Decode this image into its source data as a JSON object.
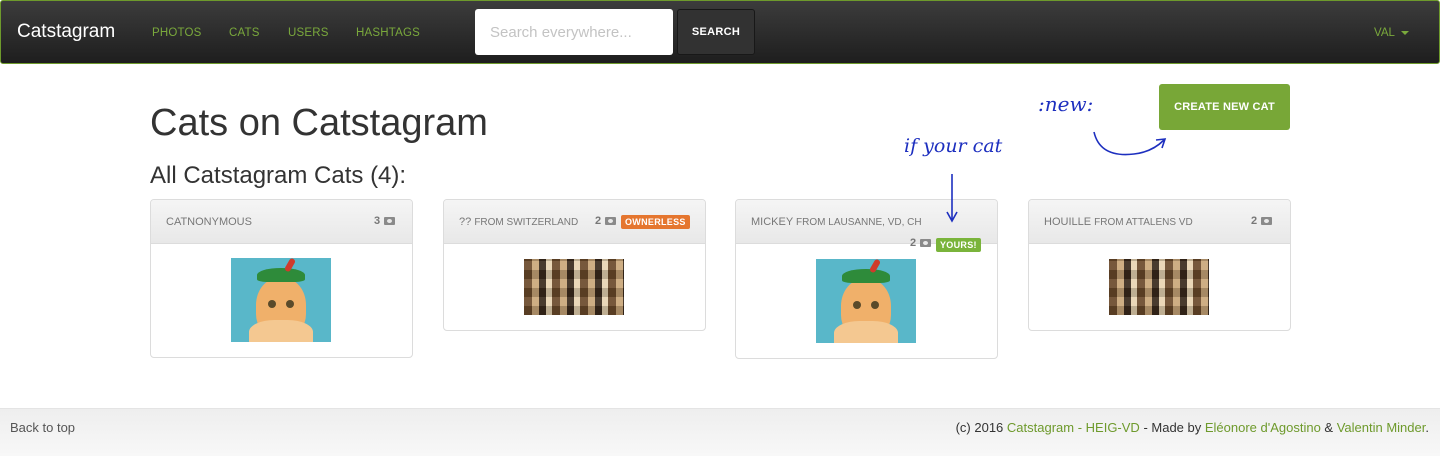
{
  "navbar": {
    "brand": "Catstagram",
    "links": [
      "PHOTOS",
      "CATS",
      "USERS",
      "HASHTAGS"
    ],
    "search_placeholder": "Search everywhere...",
    "search_button": "SEARCH",
    "user_menu": "VAL"
  },
  "page": {
    "title": "Cats on Catstagram",
    "section_title": "All Catstagram Cats (4):",
    "create_button": "CREATE NEW CAT"
  },
  "cats": [
    {
      "name": "CATNONYMOUS",
      "from": "",
      "photos": "3",
      "badge": "",
      "image": "hat-cat"
    },
    {
      "name": "??",
      "from": "FROM SWITZERLAND",
      "photos": "2",
      "badge": "OWNERLESS",
      "image": "cat-crowd"
    },
    {
      "name": "MICKEY",
      "from": "FROM LAUSANNE, VD, CH",
      "photos": "2",
      "badge": "YOURS!",
      "image": "hat-cat"
    },
    {
      "name": "HOUILLE",
      "from": "FROM ATTALENS VD",
      "photos": "2",
      "badge": "",
      "image": "cat-crowd"
    }
  ],
  "annotations": {
    "new": ":new:",
    "your_cat": "if your cat"
  },
  "footer": {
    "back_to_top": "Back to top",
    "credits_prefix": "(c) 2016 ",
    "site_link": "Catstagram - HEIG-VD",
    "made_by": " - Made by ",
    "author1": "Eléonore d'Agostino",
    "and": " & ",
    "author2": "Valentin Minder",
    "period": "."
  },
  "colors": {
    "accent": "#78a737",
    "ownerless_badge": "#e5762f",
    "yours_badge": "#7ab43b",
    "annotation_ink": "#1d2fbf"
  }
}
